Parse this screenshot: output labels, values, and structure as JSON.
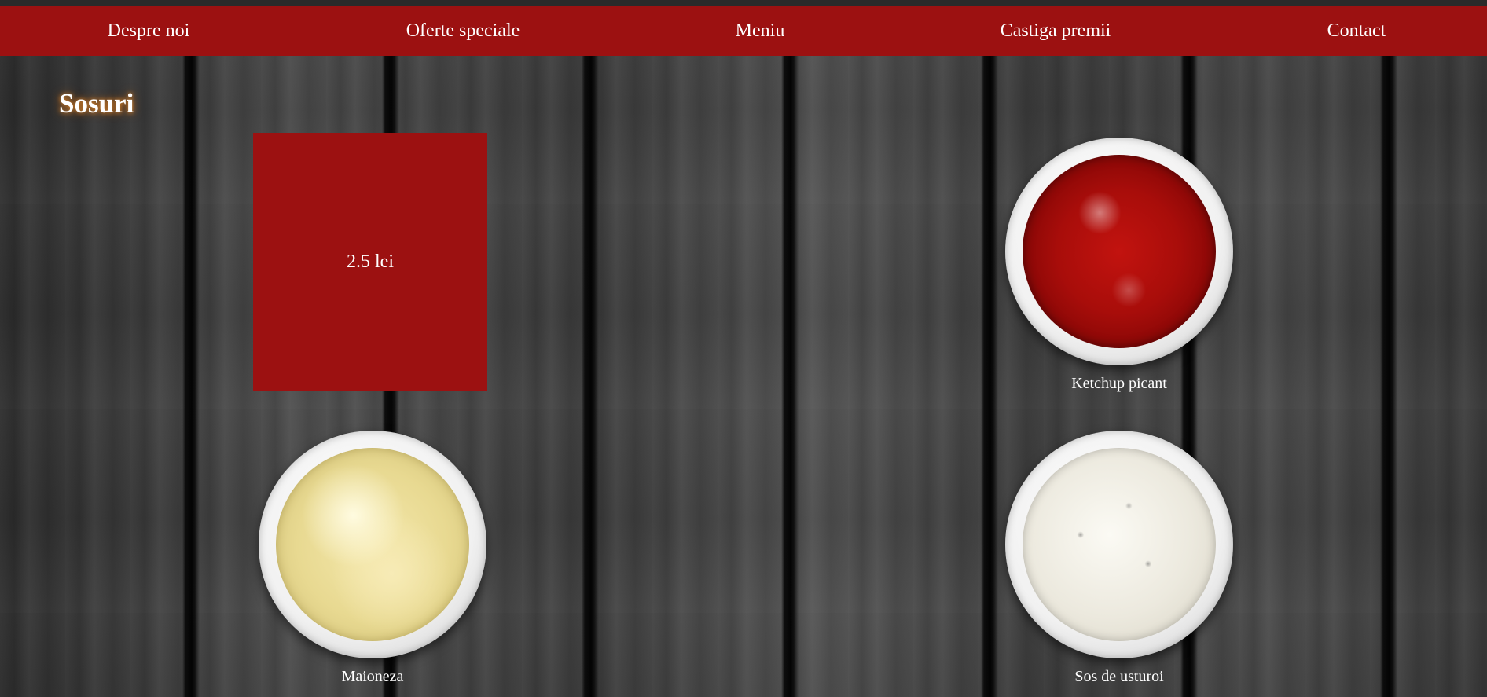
{
  "nav": {
    "items": [
      {
        "label": "Despre noi"
      },
      {
        "label": "Oferte speciale"
      },
      {
        "label": "Meniu"
      },
      {
        "label": "Castiga premii"
      },
      {
        "label": "Contact"
      }
    ]
  },
  "section": {
    "title": "Sosuri"
  },
  "price_box": {
    "label": "2.5 lei"
  },
  "products": [
    {
      "name": "Ketchup picant",
      "image": "ketchup-bowl"
    },
    {
      "name": "Maioneza",
      "image": "mayonnaise-bowl"
    },
    {
      "name": "Sos de usturoi",
      "image": "garlic-sauce-bowl"
    }
  ],
  "colors": {
    "accent_red": "#9c1111",
    "text": "#ffffff",
    "title_glow": "#e08a2c"
  }
}
